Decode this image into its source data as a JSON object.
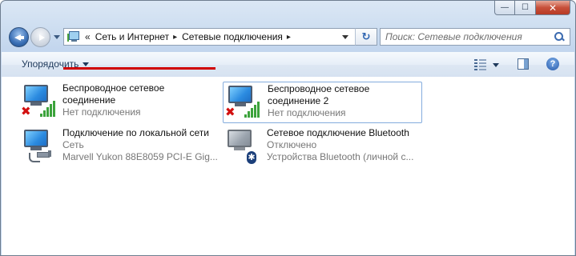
{
  "window": {
    "caption": {
      "minimize": "—",
      "maximize": "☐",
      "close": "✕"
    }
  },
  "address_bar": {
    "overflow": "«",
    "crumbs": [
      "Сеть и Интернет",
      "Сетевые подключения"
    ],
    "separator": "▸"
  },
  "search": {
    "placeholder": "Поиск: Сетевые подключения"
  },
  "command_bar": {
    "organize_label": "Упорядочить"
  },
  "connections": [
    {
      "name_line1": "Беспроводное сетевое",
      "name_line2": "соединение",
      "status": "Нет подключения",
      "device": ""
    },
    {
      "name_line1": "Беспроводное сетевое",
      "name_line2": "соединение 2",
      "status": "Нет подключения",
      "device": ""
    },
    {
      "name_line1": "Подключение по локальной сети",
      "name_line2": "",
      "status": "Сеть",
      "device": "Marvell Yukon 88E8059 PCI-E Gig..."
    },
    {
      "name_line1": "Сетевое подключение Bluetooth",
      "name_line2": "",
      "status": "Отключено",
      "device": "Устройства Bluetooth (личной с..."
    }
  ],
  "icons": {
    "bluetooth_glyph": "✱",
    "help_glyph": "?",
    "refresh_glyph": "↻",
    "error_glyph": "✖"
  },
  "colors": {
    "annotation_underline": "#d00000",
    "link_accent": "#1e395b"
  }
}
